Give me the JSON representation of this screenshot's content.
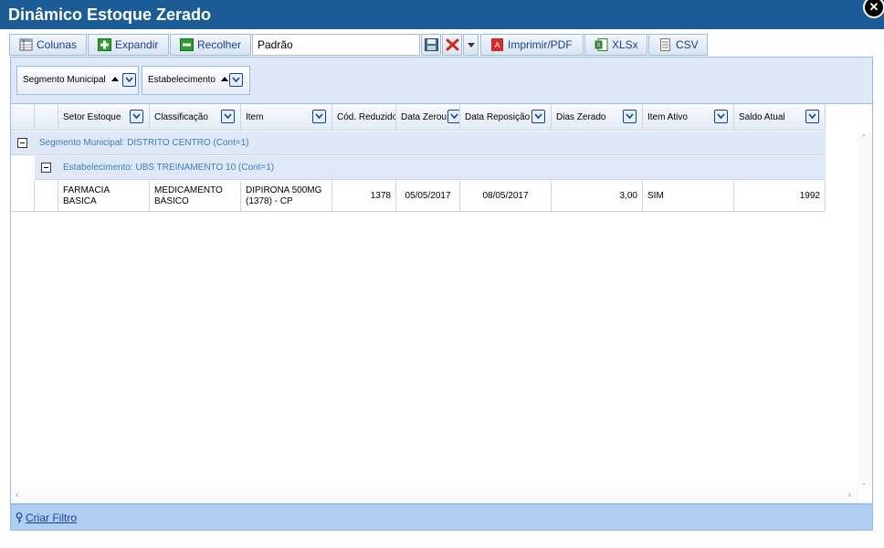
{
  "window": {
    "title": "Dinâmico Estoque Zerado"
  },
  "toolbar": {
    "columns_label": "Colunas",
    "expand_label": "Expandir",
    "collapse_label": "Recolher",
    "layout_value": "Padrão",
    "print_label": "Imprimir/PDF",
    "xlsx_label": "XLSx",
    "csv_label": "CSV"
  },
  "group_bar": {
    "chips": [
      "Segmento Municipal",
      "Estabelecimento"
    ]
  },
  "grid": {
    "columns": [
      "Setor Estoque",
      "Classificação",
      "Item",
      "Cód. Reduzido",
      "Data Zerou",
      "Data Reposição",
      "Dias Zerado",
      "Item Ativo",
      "Saldo Atual"
    ],
    "group1": "Segmento Municipal: DISTRITO CENTRO (Cont=1)",
    "group2": "Estabelecimento: UBS TREINAMENTO 10 (Cont=1)",
    "rows": [
      {
        "setor": "FARMACIA BASICA",
        "classificacao": "MEDICAMENTO BÁSICO",
        "item": "DIPIRONA 500MG (1378) - CP",
        "cod": "1378",
        "data_zerou": "05/05/2017",
        "data_reposicao": "08/05/2017",
        "dias": "3,00",
        "ativo": "SIM",
        "saldo": "1992"
      }
    ]
  },
  "footer": {
    "filter_link": "Criar Filtro"
  }
}
